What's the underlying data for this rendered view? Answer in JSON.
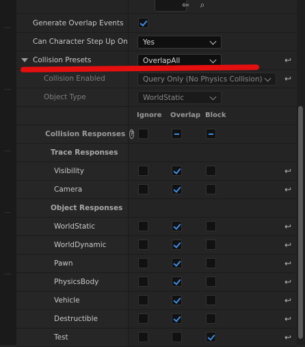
{
  "rows": {
    "generate_overlap": {
      "label": "Generate Overlap Events",
      "checked": true
    },
    "step_up": {
      "label": "Can Character Step Up On",
      "value": "Yes"
    },
    "collision_presets": {
      "label": "Collision Presets",
      "value": "OverlapAll"
    },
    "collision_enabled": {
      "label": "Collision Enabled",
      "value": "Query Only (No Physics Collision)"
    },
    "object_type": {
      "label": "Object Type",
      "value": "WorldStatic"
    }
  },
  "columns": {
    "ignore": "Ignore",
    "overlap": "Overlap",
    "block": "Block"
  },
  "collision_responses": {
    "label": "Collision Responses",
    "help": "?"
  },
  "trace_responses": {
    "label": "Trace Responses",
    "items": [
      {
        "label": "Visibility",
        "state": "overlap"
      },
      {
        "label": "Camera",
        "state": "overlap"
      }
    ]
  },
  "object_responses": {
    "label": "Object Responses",
    "items": [
      {
        "label": "WorldStatic",
        "state": "overlap"
      },
      {
        "label": "WorldDynamic",
        "state": "overlap"
      },
      {
        "label": "Pawn",
        "state": "overlap"
      },
      {
        "label": "PhysicsBody",
        "state": "overlap"
      },
      {
        "label": "Vehicle",
        "state": "overlap"
      },
      {
        "label": "Destructible",
        "state": "overlap"
      },
      {
        "label": "Test",
        "state": "block"
      }
    ]
  },
  "icons": {
    "reset": "reset-arrow-icon",
    "browse": "back-arrow-icon",
    "find": "search-asset-icon",
    "expand": "triangle-down-icon"
  },
  "colors": {
    "accent": "#3d8eea",
    "highlight": "#e60f0f"
  }
}
